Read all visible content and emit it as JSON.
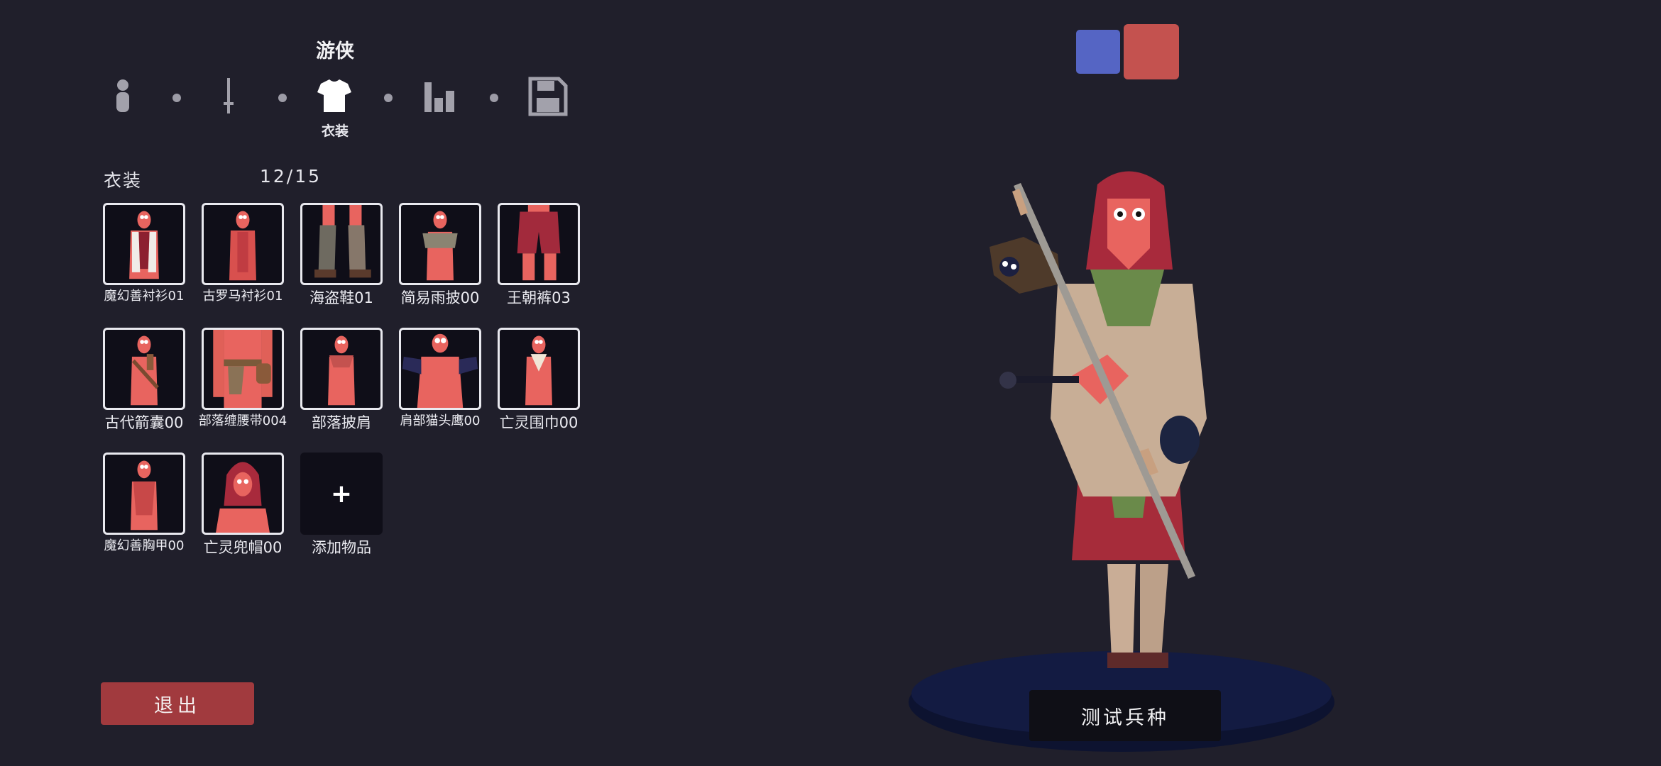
{
  "header": {
    "unit_name": "游侠",
    "steps": [
      {
        "icon": "person-icon",
        "active": false
      },
      {
        "icon": "sword-icon",
        "active": false
      },
      {
        "icon": "shirt-icon",
        "active": true,
        "label": "衣装"
      },
      {
        "icon": "bar-chart-icon",
        "active": false
      },
      {
        "icon": "save-icon",
        "active": false
      }
    ]
  },
  "section": {
    "title": "衣装",
    "count": "12/15"
  },
  "items": [
    {
      "label": "魔幻善衬衫01"
    },
    {
      "label": "古罗马衬衫01"
    },
    {
      "label": "海盗鞋01"
    },
    {
      "label": "简易雨披00"
    },
    {
      "label": "王朝裤03"
    },
    {
      "label": "古代箭囊00"
    },
    {
      "label": "部落缠腰带004"
    },
    {
      "label": "部落披肩"
    },
    {
      "label": "肩部猫头鹰00"
    },
    {
      "label": "亡灵围巾00"
    },
    {
      "label": "魔幻善胸甲00"
    },
    {
      "label": "亡灵兜帽00"
    }
  ],
  "add_item": {
    "symbol": "+",
    "label": "添加物品"
  },
  "exit_label": "退出",
  "test_label": "测试兵种",
  "teams": {
    "blue": "#5565c4",
    "red": "#c4524f"
  },
  "colors": {
    "accent_red": "#a13a3e",
    "background": "#201f2b",
    "unit_skin": "#e8645f"
  }
}
